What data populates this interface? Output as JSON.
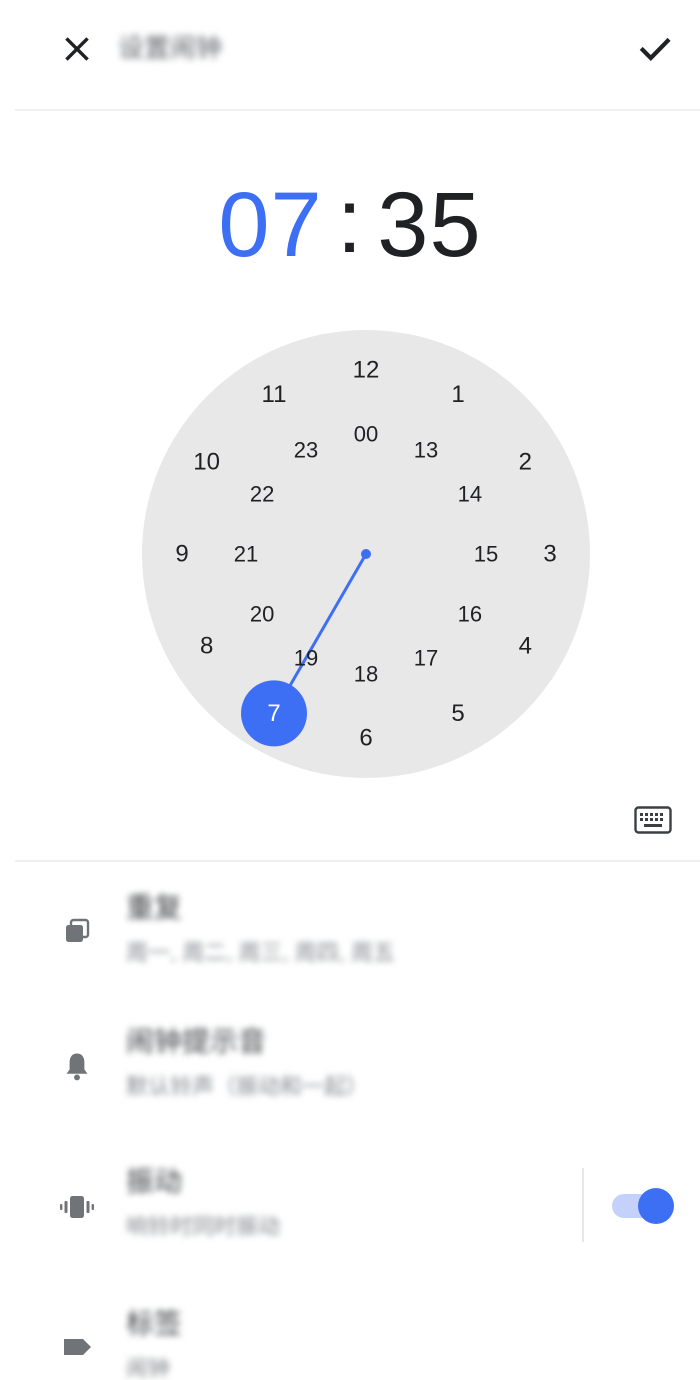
{
  "header": {
    "close_icon": "close-icon",
    "title": "设置闹钟",
    "confirm_icon": "check-icon"
  },
  "time": {
    "hour": "07",
    "separator": ":",
    "minute": "35"
  },
  "clock": {
    "outer_numbers": [
      "12",
      "1",
      "2",
      "3",
      "4",
      "5",
      "6",
      "7",
      "8",
      "9",
      "10",
      "11"
    ],
    "inner_numbers": [
      "00",
      "13",
      "14",
      "15",
      "16",
      "17",
      "18",
      "19",
      "20",
      "21",
      "22",
      "23"
    ],
    "selected": "7",
    "selected_color": "#3d6ff5",
    "face_color": "#e8e8e8"
  },
  "keyboard_icon": "keyboard-icon",
  "settings": {
    "repeat": {
      "icon": "repeat-icon",
      "title": "重复",
      "subtitle": "周一, 周二, 周三, 周四, 周五"
    },
    "ringtone": {
      "icon": "bell-icon",
      "title": "闹钟提示音",
      "subtitle": "默认铃声（振动和一起）"
    },
    "vibrate": {
      "icon": "vibrate-icon",
      "title": "振动",
      "subtitle": "响铃时同时振动",
      "enabled": true
    },
    "label": {
      "icon": "label-icon",
      "title": "标签",
      "subtitle": "闹钟"
    }
  }
}
